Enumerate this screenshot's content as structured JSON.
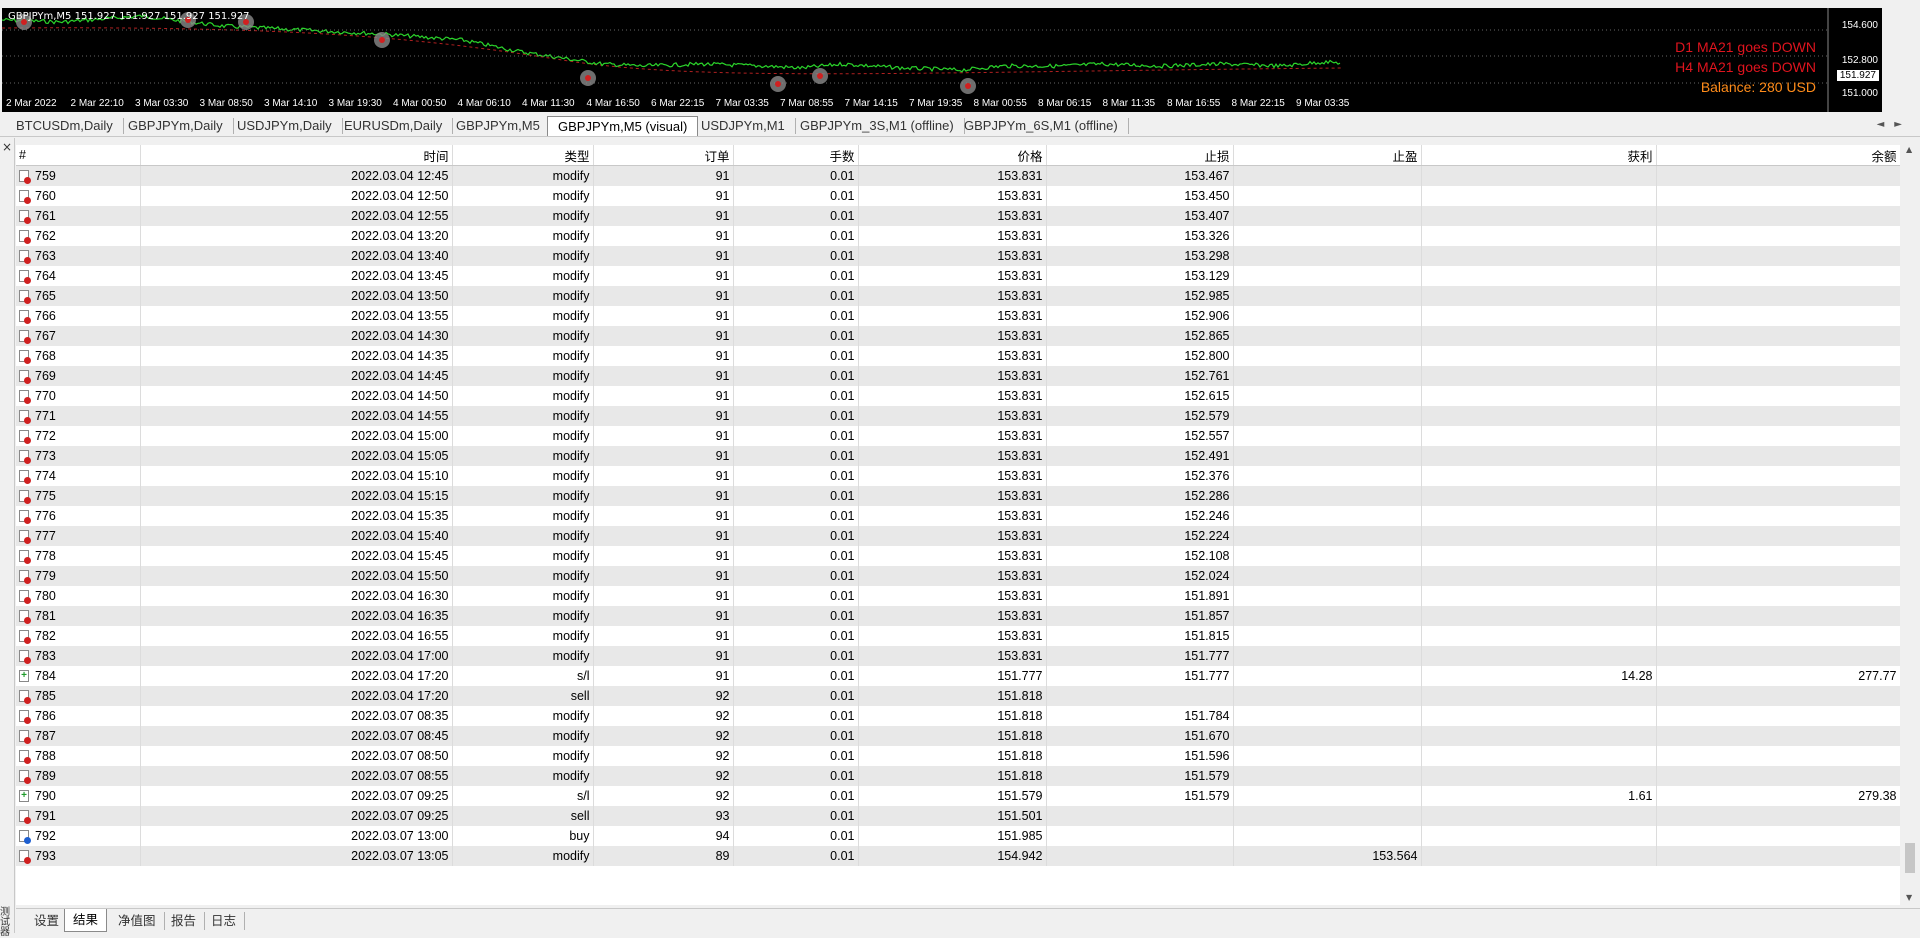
{
  "chart": {
    "title": "GBPJPYm,M5  151.927 151.927 151.927 151.927",
    "signals": [
      "D1 MA21 goes DOWN",
      "H4 MA21 goes DOWN",
      "Balance: 280 USD"
    ],
    "x_ticks": [
      "2 Mar 2022",
      "2 Mar 22:10",
      "3 Mar 03:30",
      "3 Mar 08:50",
      "3 Mar 14:10",
      "3 Mar 19:30",
      "4 Mar 00:50",
      "4 Mar 06:10",
      "4 Mar 11:30",
      "4 Mar 16:50",
      "6 Mar 22:15",
      "7 Mar 03:35",
      "7 Mar 08:55",
      "7 Mar 14:15",
      "7 Mar 19:35",
      "8 Mar 00:55",
      "8 Mar 06:15",
      "8 Mar 11:35",
      "8 Mar 16:55",
      "8 Mar 22:15",
      "9 Mar 03:35"
    ],
    "y_ticks": [
      "154.600",
      "152.800",
      "151.000"
    ],
    "y_current": "151.927",
    "colors": {
      "price": "#2bd62b",
      "ma": "#b02020",
      "signal": "#e0141e",
      "balance": "#ff8c1a"
    }
  },
  "chart_tabs": [
    "BTCUSDm,Daily",
    "GBPJPYm,Daily",
    "USDJPYm,Daily",
    "EURUSDm,Daily",
    "GBPJPYm,M5",
    "GBPJPYm,M5 (visual)",
    "USDJPYm,M1",
    "GBPJPYm_3S,M1 (offline)",
    "GBPJPYm_6S,M1 (offline)"
  ],
  "active_chart_tab": "GBPJPYm,M5 (visual)",
  "table": {
    "columns": [
      "#",
      "时间",
      "类型",
      "订单",
      "手数",
      "价格",
      "止损",
      "止盈",
      "获利",
      "余额"
    ],
    "rows": [
      [
        "759",
        "2022.03.04 12:45",
        "modify",
        "91",
        "0.01",
        "153.831",
        "153.467",
        "",
        "",
        ""
      ],
      [
        "760",
        "2022.03.04 12:50",
        "modify",
        "91",
        "0.01",
        "153.831",
        "153.450",
        "",
        "",
        ""
      ],
      [
        "761",
        "2022.03.04 12:55",
        "modify",
        "91",
        "0.01",
        "153.831",
        "153.407",
        "",
        "",
        ""
      ],
      [
        "762",
        "2022.03.04 13:20",
        "modify",
        "91",
        "0.01",
        "153.831",
        "153.326",
        "",
        "",
        ""
      ],
      [
        "763",
        "2022.03.04 13:40",
        "modify",
        "91",
        "0.01",
        "153.831",
        "153.298",
        "",
        "",
        ""
      ],
      [
        "764",
        "2022.03.04 13:45",
        "modify",
        "91",
        "0.01",
        "153.831",
        "153.129",
        "",
        "",
        ""
      ],
      [
        "765",
        "2022.03.04 13:50",
        "modify",
        "91",
        "0.01",
        "153.831",
        "152.985",
        "",
        "",
        ""
      ],
      [
        "766",
        "2022.03.04 13:55",
        "modify",
        "91",
        "0.01",
        "153.831",
        "152.906",
        "",
        "",
        ""
      ],
      [
        "767",
        "2022.03.04 14:30",
        "modify",
        "91",
        "0.01",
        "153.831",
        "152.865",
        "",
        "",
        ""
      ],
      [
        "768",
        "2022.03.04 14:35",
        "modify",
        "91",
        "0.01",
        "153.831",
        "152.800",
        "",
        "",
        ""
      ],
      [
        "769",
        "2022.03.04 14:45",
        "modify",
        "91",
        "0.01",
        "153.831",
        "152.761",
        "",
        "",
        ""
      ],
      [
        "770",
        "2022.03.04 14:50",
        "modify",
        "91",
        "0.01",
        "153.831",
        "152.615",
        "",
        "",
        ""
      ],
      [
        "771",
        "2022.03.04 14:55",
        "modify",
        "91",
        "0.01",
        "153.831",
        "152.579",
        "",
        "",
        ""
      ],
      [
        "772",
        "2022.03.04 15:00",
        "modify",
        "91",
        "0.01",
        "153.831",
        "152.557",
        "",
        "",
        ""
      ],
      [
        "773",
        "2022.03.04 15:05",
        "modify",
        "91",
        "0.01",
        "153.831",
        "152.491",
        "",
        "",
        ""
      ],
      [
        "774",
        "2022.03.04 15:10",
        "modify",
        "91",
        "0.01",
        "153.831",
        "152.376",
        "",
        "",
        ""
      ],
      [
        "775",
        "2022.03.04 15:15",
        "modify",
        "91",
        "0.01",
        "153.831",
        "152.286",
        "",
        "",
        ""
      ],
      [
        "776",
        "2022.03.04 15:35",
        "modify",
        "91",
        "0.01",
        "153.831",
        "152.246",
        "",
        "",
        ""
      ],
      [
        "777",
        "2022.03.04 15:40",
        "modify",
        "91",
        "0.01",
        "153.831",
        "152.224",
        "",
        "",
        ""
      ],
      [
        "778",
        "2022.03.04 15:45",
        "modify",
        "91",
        "0.01",
        "153.831",
        "152.108",
        "",
        "",
        ""
      ],
      [
        "779",
        "2022.03.04 15:50",
        "modify",
        "91",
        "0.01",
        "153.831",
        "152.024",
        "",
        "",
        ""
      ],
      [
        "780",
        "2022.03.04 16:30",
        "modify",
        "91",
        "0.01",
        "153.831",
        "151.891",
        "",
        "",
        ""
      ],
      [
        "781",
        "2022.03.04 16:35",
        "modify",
        "91",
        "0.01",
        "153.831",
        "151.857",
        "",
        "",
        ""
      ],
      [
        "782",
        "2022.03.04 16:55",
        "modify",
        "91",
        "0.01",
        "153.831",
        "151.815",
        "",
        "",
        ""
      ],
      [
        "783",
        "2022.03.04 17:00",
        "modify",
        "91",
        "0.01",
        "153.831",
        "151.777",
        "",
        "",
        ""
      ],
      [
        "784",
        "2022.03.04 17:20",
        "s/l",
        "91",
        "0.01",
        "151.777",
        "151.777",
        "",
        "14.28",
        "277.77"
      ],
      [
        "785",
        "2022.03.04 17:20",
        "sell",
        "92",
        "0.01",
        "151.818",
        "",
        "",
        "",
        ""
      ],
      [
        "786",
        "2022.03.07 08:35",
        "modify",
        "92",
        "0.01",
        "151.818",
        "151.784",
        "",
        "",
        ""
      ],
      [
        "787",
        "2022.03.07 08:45",
        "modify",
        "92",
        "0.01",
        "151.818",
        "151.670",
        "",
        "",
        ""
      ],
      [
        "788",
        "2022.03.07 08:50",
        "modify",
        "92",
        "0.01",
        "151.818",
        "151.596",
        "",
        "",
        ""
      ],
      [
        "789",
        "2022.03.07 08:55",
        "modify",
        "92",
        "0.01",
        "151.818",
        "151.579",
        "",
        "",
        ""
      ],
      [
        "790",
        "2022.03.07 09:25",
        "s/l",
        "92",
        "0.01",
        "151.579",
        "151.579",
        "",
        "1.61",
        "279.38"
      ],
      [
        "791",
        "2022.03.07 09:25",
        "sell",
        "93",
        "0.01",
        "151.501",
        "",
        "",
        "",
        ""
      ],
      [
        "792",
        "2022.03.07 13:00",
        "buy",
        "94",
        "0.01",
        "151.985",
        "",
        "",
        "",
        ""
      ],
      [
        "793",
        "2022.03.07 13:05",
        "modify",
        "89",
        "0.01",
        "154.942",
        "",
        "153.564",
        "",
        ""
      ]
    ]
  },
  "bottom_tabs": [
    "设置",
    "结果",
    "净值图",
    "报告",
    "日志"
  ],
  "active_bottom_tab": "结果",
  "side_label": "测试器"
}
